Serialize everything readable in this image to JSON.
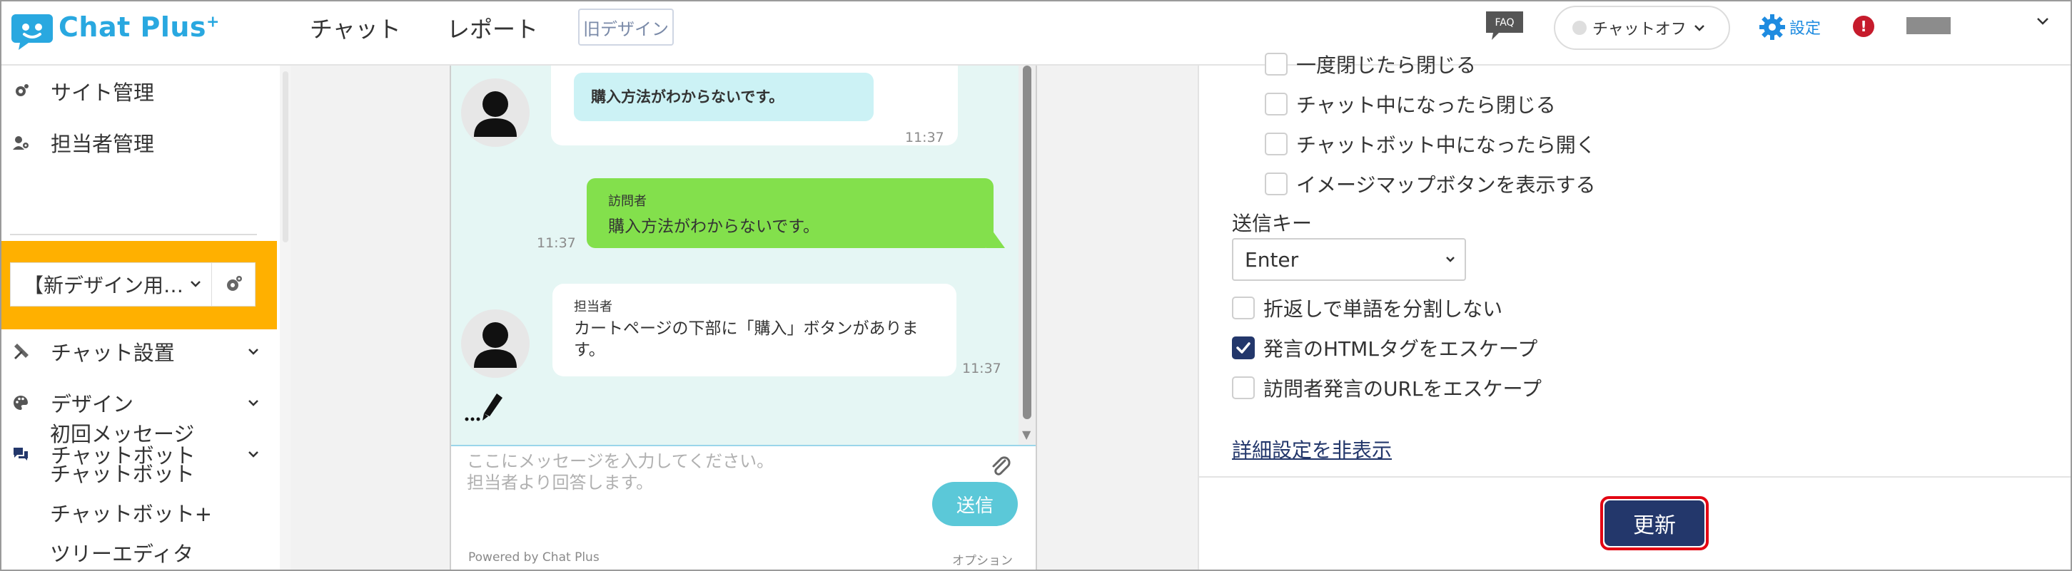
{
  "header": {
    "logo_text": "Chat Plus",
    "logo_sup": "+",
    "nav": [
      "チャット",
      "レポート"
    ],
    "old_design": "旧デザイン",
    "faq": "FAQ",
    "chat_status": "チャットオフ",
    "settings": "設定",
    "alert": "!"
  },
  "sidebar": {
    "items_top": [
      {
        "label": "サイト管理",
        "icon": "gear-icon"
      },
      {
        "label": "担当者管理",
        "icon": "people-gear-icon"
      }
    ],
    "site_select": "【新デザイン用…",
    "items_main": [
      {
        "label": "チャット設置",
        "icon": "tools-icon"
      },
      {
        "label": "デザイン",
        "icon": "palette-icon"
      },
      {
        "label": "チャットボット",
        "icon": "chat-bubbles-icon"
      }
    ],
    "sub_items": [
      "初回メッセージ",
      "チャットボット",
      "チャットボット+",
      "ツリーエディタ"
    ]
  },
  "chat_preview": {
    "visitor_msg_1": "購入方法がわからないです。",
    "time_1": "11:37",
    "visitor_label": "訪問者",
    "visitor_msg_2": "購入方法がわからないです。",
    "time_2": "11:37",
    "agent_label": "担当者",
    "agent_msg": "カートページの下部に「購入」ボタンがあります。",
    "time_3": "11:37",
    "input_placeholder_1": "ここにメッセージを入力してください。",
    "input_placeholder_2": "担当者より回答します。",
    "send": "送信",
    "powered_by": "Powered by Chat Plus",
    "option": "オプション"
  },
  "settings_panel": {
    "checkboxes_top": [
      {
        "label": "一度閉じたら閉じる",
        "checked": false
      },
      {
        "label": "チャット中になったら閉じる",
        "checked": false
      },
      {
        "label": "チャットボット中になったら開く",
        "checked": false
      },
      {
        "label": "イメージマップボタンを表示する",
        "checked": false
      }
    ],
    "send_key_label": "送信キー",
    "send_key_value": "Enter",
    "checkboxes_bottom": [
      {
        "label": "折返しで単語を分割しない",
        "checked": false
      },
      {
        "label": "発言のHTMLタグをエスケープ",
        "checked": true
      },
      {
        "label": "訪問者発言のURLをエスケープ",
        "checked": false
      }
    ],
    "hide_details_link": "詳細設定を非表示",
    "update_button": "更新"
  },
  "colors": {
    "brand": "#29a8e0",
    "navy": "#23376b",
    "highlight": "#ffb000",
    "chat_bg": "#e5f6f4",
    "visitor_bubble": "#83e04c",
    "alert": "#c61b2c"
  }
}
